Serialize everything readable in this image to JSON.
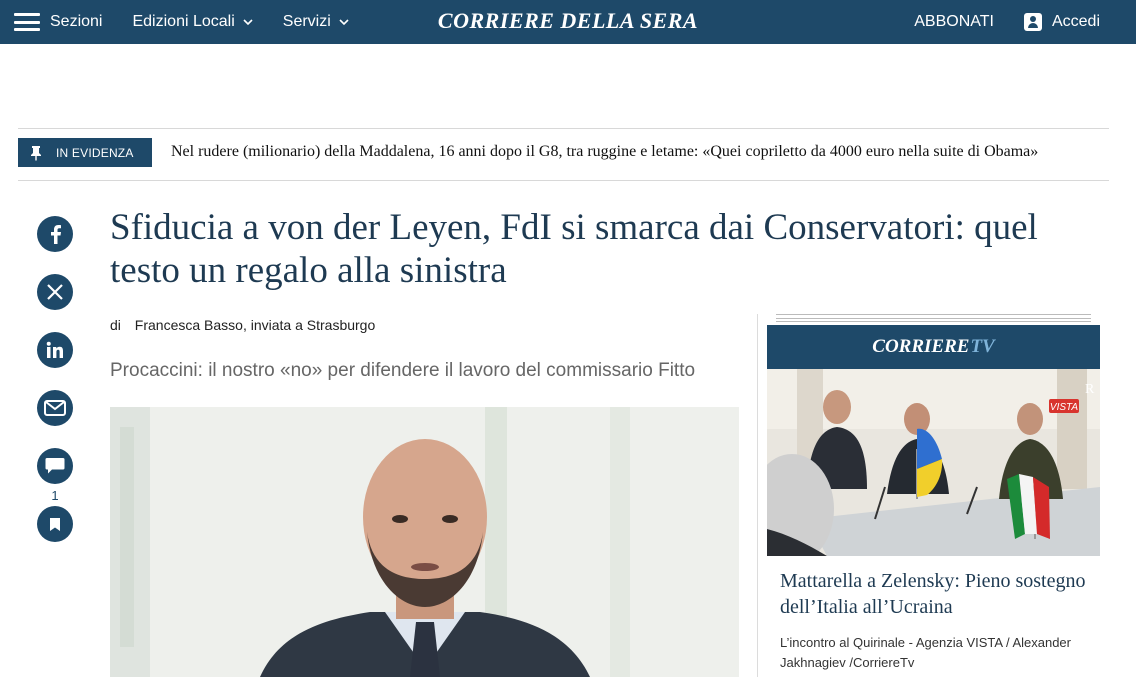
{
  "header": {
    "sections_label": "Sezioni",
    "edizioni_label": "Edizioni Locali",
    "servizi_label": "Servizi",
    "logo": "CORRIERE DELLA SERA",
    "abbonati_label": "ABBONATI",
    "accedi_label": "Accedi"
  },
  "evidenza": {
    "badge": "IN EVIDENZA",
    "text": "Nel rudere (milionario) della Maddalena, 16 anni dopo il G8, tra ruggine e letame: «Quei copriletto da 4000 euro nella suite di Obama»"
  },
  "social": {
    "comment_count": "1"
  },
  "article": {
    "headline": "Sfiducia a von der Leyen, FdI si smarca dai Conservatori: quel testo un regalo alla sinistra",
    "byline_prefix": "di",
    "byline": "Francesca Basso, inviata a Strasburgo",
    "subtitle": "Procaccini: il nostro «no» per difendere il lavoro del commissario Fitto"
  },
  "corriere_tv": {
    "brand_main": "CORRIERE",
    "brand_tv": "TV",
    "video_watermark": "VISTA",
    "title": "Mattarella a Zelensky: Pieno sostegno dell’Italia all’Ucraina",
    "caption": "L’incontro al Quirinale - Agenzia VISTA / Alexander Jakhnagiev /CorriereTv"
  },
  "colors": {
    "brand_blue": "#1e4969",
    "headline_blue": "#1e3a52"
  }
}
